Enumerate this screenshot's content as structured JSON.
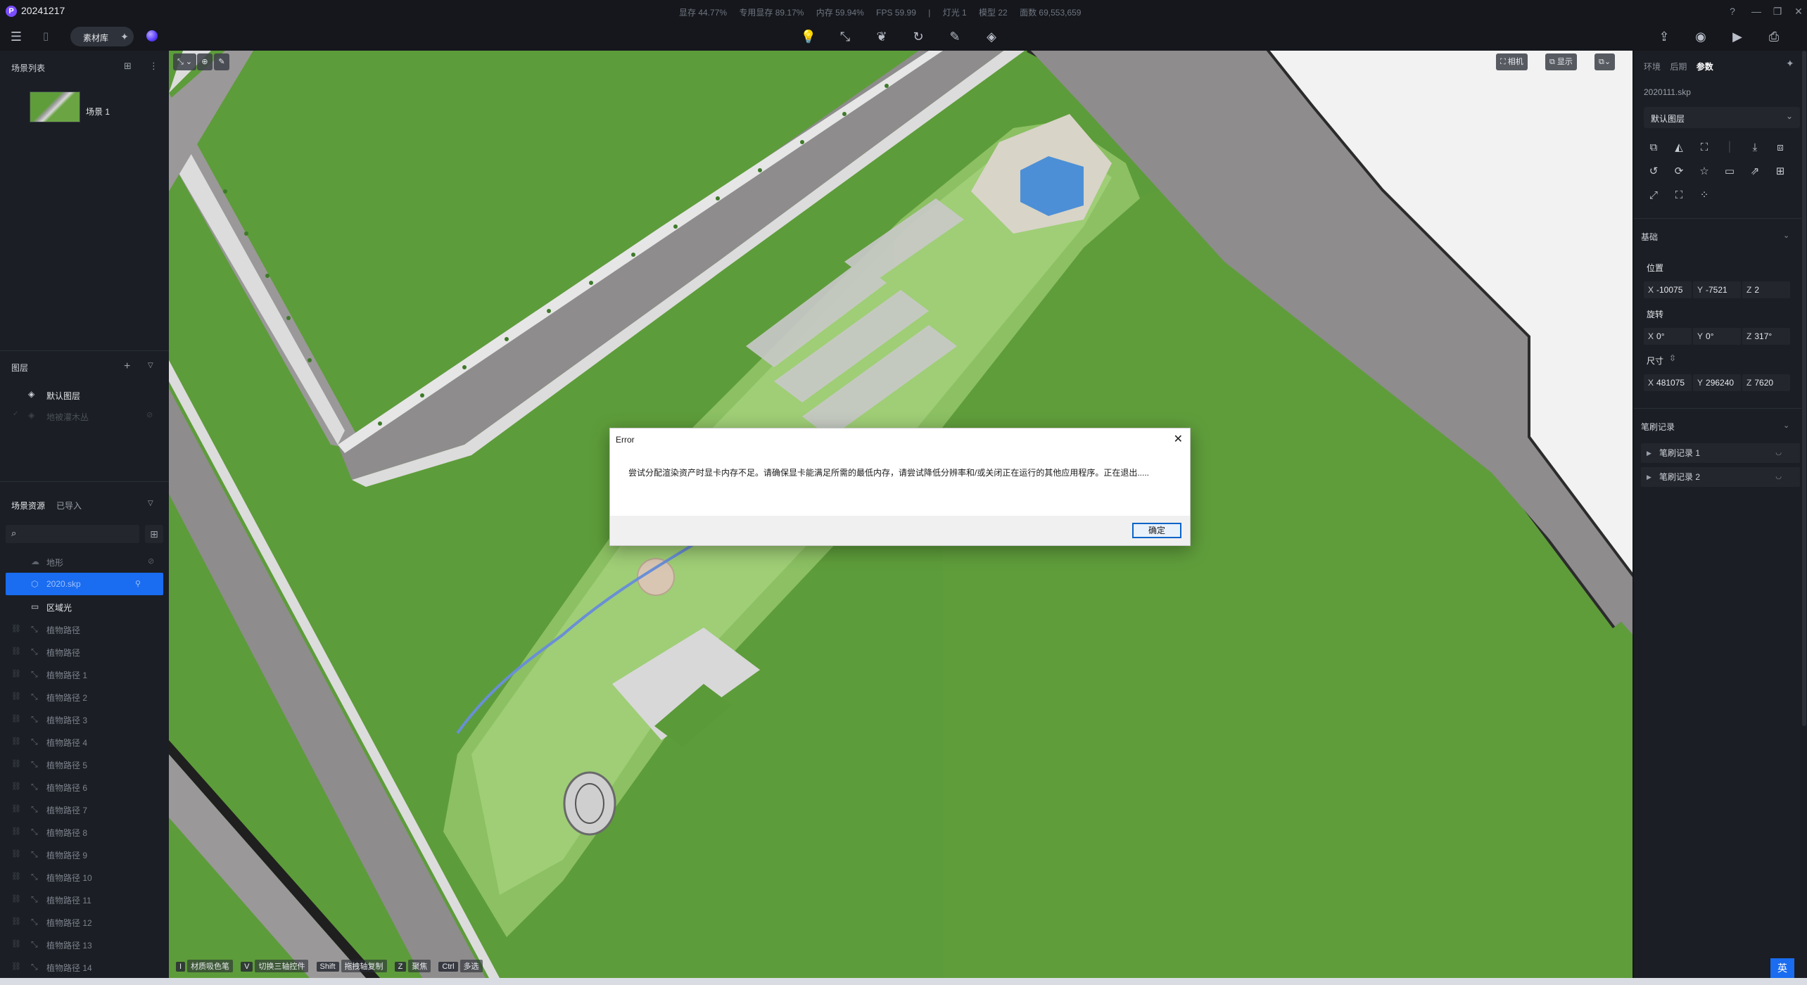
{
  "window": {
    "title": "20241217",
    "logo_letter": "P",
    "stats": [
      "显存 44.77%",
      "专用显存 89.17%",
      "内存 59.94%",
      "FPS 59.99",
      "|",
      "灯光 1",
      "模型 22",
      "面数 69,553,659"
    ]
  },
  "toolbar": {
    "material_label": "素材库"
  },
  "left_panel": {
    "scenes_title": "场景列表",
    "scene_name": "场景 1",
    "layers_title": "图层",
    "layers": [
      "默认图层",
      "地被灌木丛"
    ],
    "resources_tabs": [
      "场景资源",
      "已导入"
    ],
    "resources": [
      {
        "label": "地形",
        "state": "dim"
      },
      {
        "label": "2020.skp",
        "state": "selected"
      },
      {
        "label": "区域光",
        "state": "bright"
      },
      {
        "label": "植物路径",
        "state": "dim"
      },
      {
        "label": "植物路径",
        "state": "dim"
      },
      {
        "label": "植物路径 1",
        "state": "dim"
      },
      {
        "label": "植物路径 2",
        "state": "dim"
      },
      {
        "label": "植物路径 3",
        "state": "dim"
      },
      {
        "label": "植物路径 4",
        "state": "dim"
      },
      {
        "label": "植物路径 5",
        "state": "dim"
      },
      {
        "label": "植物路径 6",
        "state": "dim"
      },
      {
        "label": "植物路径 7",
        "state": "dim"
      },
      {
        "label": "植物路径 8",
        "state": "dim"
      },
      {
        "label": "植物路径 9",
        "state": "dim"
      },
      {
        "label": "植物路径 10",
        "state": "dim"
      },
      {
        "label": "植物路径 11",
        "state": "dim"
      },
      {
        "label": "植物路径 12",
        "state": "dim"
      },
      {
        "label": "植物路径 13",
        "state": "dim"
      },
      {
        "label": "植物路径 14",
        "state": "dim"
      }
    ]
  },
  "viewport": {
    "camera_label": "相机",
    "display_label": "显示",
    "hints": [
      {
        "key": "I",
        "label": "材质吸色笔"
      },
      {
        "key": "V",
        "label": "切换三轴控件"
      },
      {
        "key": "Shift",
        "label": "拖拽轴复制"
      },
      {
        "key": "Z",
        "label": "聚焦"
      },
      {
        "key": "Ctrl",
        "label": "多选"
      }
    ]
  },
  "right_panel": {
    "tabs": [
      "环境",
      "后期",
      "参数"
    ],
    "active_tab": "参数",
    "file_name": "2020111.skp",
    "layer_select": "默认图层",
    "basic_title": "基础",
    "position_label": "位置",
    "position": {
      "x": "-10075",
      "y": "-7521",
      "z": "2"
    },
    "rotation_label": "旋转",
    "rotation": {
      "x": "0°",
      "y": "0°",
      "z": "317°"
    },
    "size_label": "尺寸",
    "size": {
      "x": "481075",
      "y": "296240",
      "z": "7620"
    },
    "brush_title": "笔刷记录",
    "brushes": [
      "笔刷记录 1",
      "笔刷记录 2"
    ]
  },
  "dialog": {
    "title": "Error",
    "message": "尝试分配渲染资产时显卡内存不足。请确保显卡能满足所需的最低内存，请尝试降低分辨率和/或关闭正在运行的其他应用程序。正在退出.....",
    "ok_label": "确定"
  },
  "ime_label": "英",
  "colors": {
    "grass": "#5f9d3b",
    "road": "#8b8989",
    "accent": "#1a6cf0",
    "panel": "#1b1e24"
  }
}
